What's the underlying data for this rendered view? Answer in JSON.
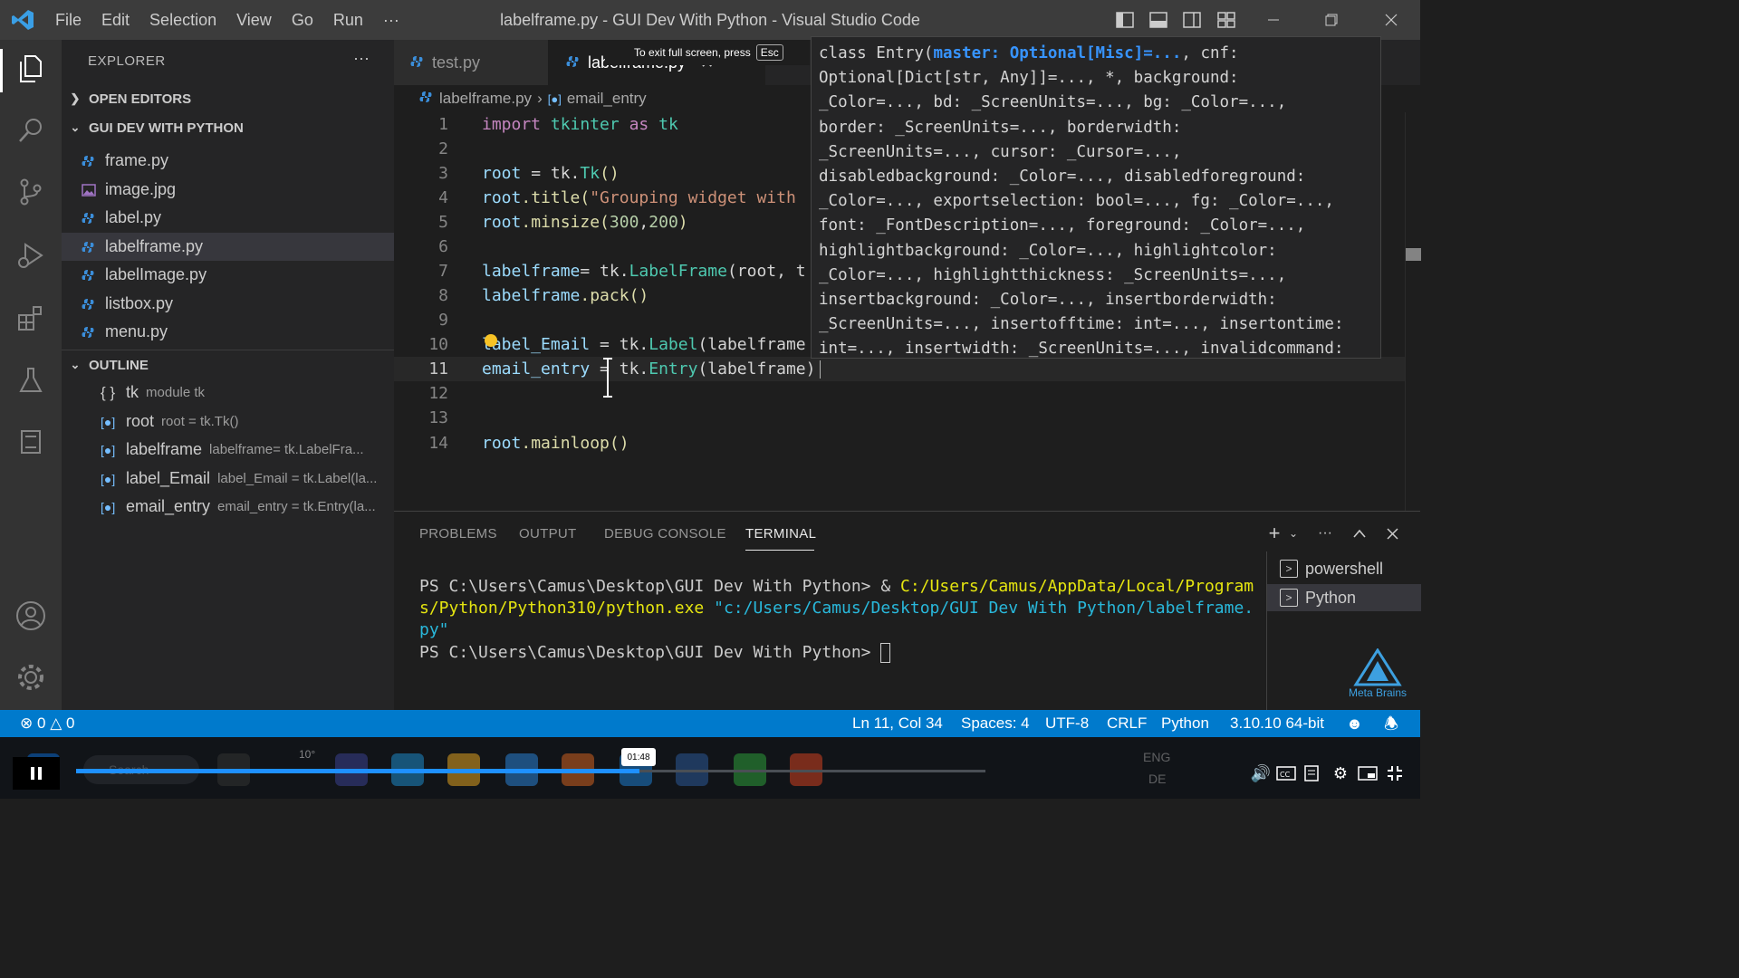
{
  "window": {
    "title": "labelframe.py - GUI Dev With Python - Visual Studio Code",
    "menu": [
      "File",
      "Edit",
      "Selection",
      "View",
      "Go",
      "Run",
      "···"
    ]
  },
  "fullscreen_hint": {
    "text": "To exit full screen, press",
    "key": "Esc"
  },
  "sidebar": {
    "title": "EXPLORER",
    "more": "···",
    "open_editors": "OPEN EDITORS",
    "folder": "GUI DEV WITH PYTHON",
    "files": [
      "frame.py",
      "image.jpg",
      "label.py",
      "labelframe.py",
      "labelImage.py",
      "listbox.py",
      "menu.py"
    ],
    "outline_title": "OUTLINE",
    "outline": [
      {
        "name": "tk",
        "detail": "module tk"
      },
      {
        "name": "root",
        "detail": "root = tk.Tk()"
      },
      {
        "name": "labelframe",
        "detail": "labelframe= tk.LabelFra..."
      },
      {
        "name": "label_Email",
        "detail": "label_Email = tk.Label(la..."
      },
      {
        "name": "email_entry",
        "detail": "email_entry = tk.Entry(la..."
      }
    ]
  },
  "tabs": {
    "inactive": "test.py",
    "active": "labelframe.py"
  },
  "breadcrumb": {
    "file": "labelframe.py",
    "symbol": "email_entry"
  },
  "editor": {
    "line_numbers": [
      "1",
      "2",
      "3",
      "4",
      "5",
      "6",
      "7",
      "8",
      "9",
      "10",
      "11",
      "12",
      "13",
      "14"
    ],
    "code": {
      "l1_import": "import",
      "l1_mod": "tkinter",
      "l1_as": "as",
      "l1_alias": "tk",
      "l3_var": "root",
      "l3_rest": " = tk.",
      "l3_cls": "Tk",
      "l3_end": "()",
      "l4_var": "root",
      "l4_fn": ".title(",
      "l4_str": "\"Grouping widget with",
      "l5_var": "root",
      "l5_fn": ".minsize(",
      "l5_n1": "300",
      "l5_comma": ",",
      "l5_n2": "200",
      "l5_end": ")",
      "l7_var": "labelframe",
      "l7_rest": "= tk.",
      "l7_cls": "LabelFrame",
      "l7_args": "(root, t",
      "l8_var": "labelframe",
      "l8_fn": ".pack",
      "l8_end": "()",
      "l10_var": "label_Email",
      "l10_rest": " = tk.",
      "l10_cls": "Label",
      "l10_args": "(labelframe",
      "l11_var": "email_entry",
      "l11_rest": " = tk.",
      "l11_cls": "Entry",
      "l11_args": "(labelframe)",
      "l14_var": "root",
      "l14_fn": ".mainloop",
      "l14_end": "()"
    }
  },
  "hover": {
    "prefix": "class Entry(",
    "highlight": "master: Optional[Misc]=...",
    "line1_rest": ", cnf:",
    "lines": [
      "Optional[Dict[str, Any]]=..., *, background:",
      "_Color=..., bd: _ScreenUnits=..., bg: _Color=...,",
      "border: _ScreenUnits=..., borderwidth:",
      "_ScreenUnits=..., cursor: _Cursor=...,",
      "disabledbackground: _Color=..., disabledforeground:",
      "_Color=..., exportselection: bool=..., fg: _Color=...,",
      "font: _FontDescription=..., foreground: _Color=...,",
      "highlightbackground: _Color=..., highlightcolor:",
      "_Color=..., highlightthickness: _ScreenUnits=...,",
      "insertbackground: _Color=..., insertborderwidth:",
      "_ScreenUnits=..., insertofftime: int=..., insertontime:",
      "int=..., insertwidth: _ScreenUnits=..., invalidcommand:"
    ]
  },
  "panel": {
    "tabs": [
      "PROBLEMS",
      "OUTPUT",
      "DEBUG CONSOLE",
      "TERMINAL"
    ],
    "terminal": {
      "line1_prompt": "PS C:\\Users\\Camus\\Desktop\\GUI Dev With Python> & ",
      "line1_path": "C:/Users/Camus/AppData/Local/Program",
      "line2_path": "s/Python/Python310/python.exe",
      "line2_arg": " \"c:/Users/Camus/Desktop/GUI Dev With Python/labelframe.",
      "line3_arg": "py\"",
      "line4_prompt": "PS C:\\Users\\Camus\\Desktop\\GUI Dev With Python> "
    },
    "terminals": [
      "powershell",
      "Python"
    ]
  },
  "statusbar": {
    "errors": "0",
    "warnings": "0",
    "position": "Ln 11, Col 34",
    "spaces": "Spaces: 4",
    "encoding": "UTF-8",
    "eol": "CRLF",
    "language": "Python",
    "interpreter": "3.10.10 64-bit"
  },
  "watermark": "Meta Brains",
  "player": {
    "time": "01:48",
    "progress": 0.62,
    "search_placeholder": "Search",
    "weather": "10°",
    "lang_top": "ENG",
    "lang_bottom": "DE"
  },
  "colors": {
    "accent": "#007acc",
    "activitybar": "#333333",
    "sidebar": "#252526",
    "editor": "#1e1e1e",
    "progress": "#1e90ff"
  }
}
